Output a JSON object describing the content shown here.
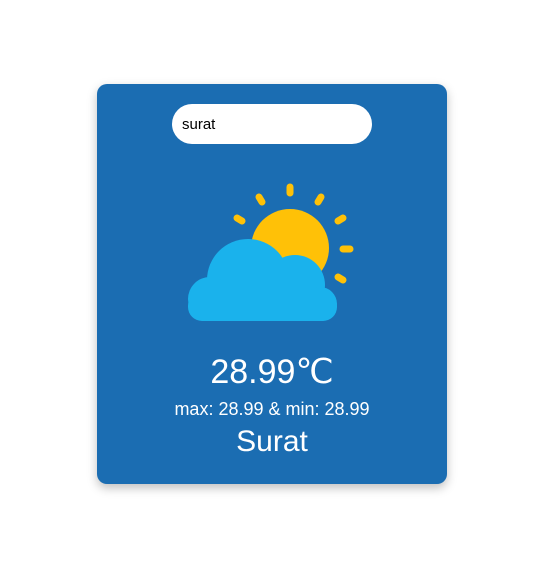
{
  "search": {
    "value": "surat"
  },
  "weather": {
    "icon": "partly-cloudy-icon",
    "temperature": "28.99",
    "unit": "℃",
    "minmax": "max: 28.99 & min: 28.99",
    "city": "Surat"
  },
  "colors": {
    "card": "#1b6db2",
    "sun": "#ffc107",
    "cloud": "#1ab2ec",
    "text": "#ffffff"
  }
}
